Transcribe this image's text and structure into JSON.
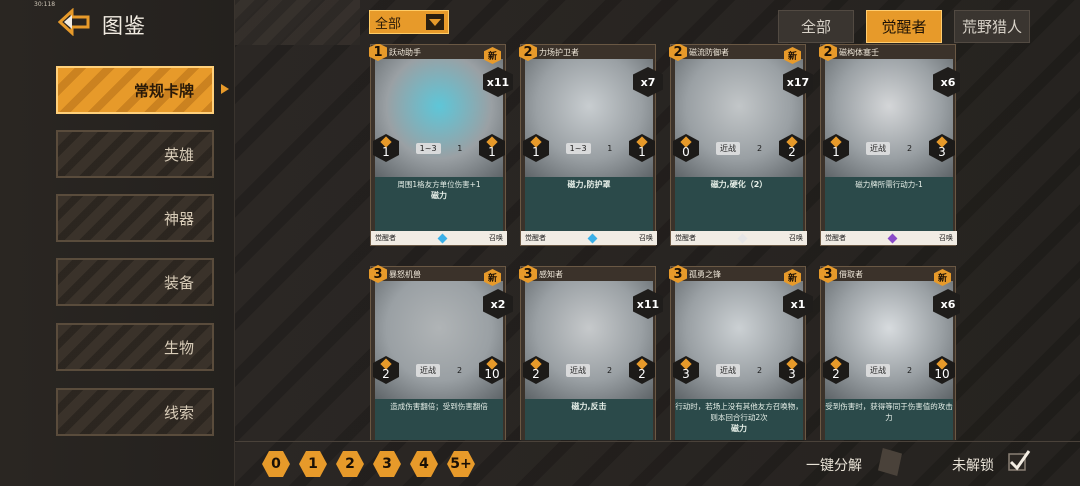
{
  "status": {
    "clock": "30:118"
  },
  "header": {
    "title": "图鉴"
  },
  "sidebar": {
    "items": [
      {
        "label": "常规卡牌",
        "active": true
      },
      {
        "label": "英雄"
      },
      {
        "label": "神器"
      },
      {
        "label": "装备"
      },
      {
        "label": "生物"
      },
      {
        "label": "线索"
      }
    ]
  },
  "filter": {
    "selected": "全部"
  },
  "tabs": [
    {
      "label": "全部"
    },
    {
      "label": "觉醒者",
      "active": true
    },
    {
      "label": "荒野猎人"
    }
  ],
  "cards": [
    {
      "cost": "1",
      "name": "跃动助手",
      "new": "新",
      "count": "x11",
      "left": "1",
      "range": "1~3",
      "mid": "1",
      "right": "1",
      "desc": "周围1格友方单位伤害+1",
      "kw": "磁力",
      "faction": "觉醒者",
      "type": "召唤",
      "gem": "#3ab0e8",
      "art": "#5ec6d8"
    },
    {
      "cost": "2",
      "name": "力场护卫者",
      "new": "",
      "count": "x7",
      "left": "1",
      "range": "1~3",
      "mid": "1",
      "right": "1",
      "desc": "",
      "kw": "磁力,防护罩",
      "faction": "觉醒者",
      "type": "召唤",
      "gem": "#3ab0e8",
      "art": "#c8cdd0"
    },
    {
      "cost": "2",
      "name": "磁流防御者",
      "new": "新",
      "count": "x17",
      "left": "0",
      "range": "近战",
      "mid": "2",
      "right": "2",
      "desc": "",
      "kw": "磁力,硬化（2）",
      "faction": "觉醒者",
      "type": "召唤",
      "gem": "#e6e6e6",
      "art": "#c2c6c8"
    },
    {
      "cost": "2",
      "name": "磁构体塞壬",
      "new": "",
      "count": "x6",
      "left": "1",
      "range": "近战",
      "mid": "2",
      "right": "3",
      "desc": "磁力牌所需行动力-1",
      "kw": "",
      "faction": "觉醒者",
      "type": "召唤",
      "gem": "#8a4bc8",
      "art": "#d4d6d8"
    },
    {
      "cost": "3",
      "name": "暴怒机兽",
      "new": "新",
      "count": "x2",
      "left": "2",
      "range": "近战",
      "mid": "2",
      "right": "10",
      "desc": "造成伤害翻倍；受到伤害翻倍",
      "kw": "",
      "faction": "",
      "type": "",
      "gem": "",
      "art": "#b0b4b6"
    },
    {
      "cost": "3",
      "name": "感知者",
      "new": "",
      "count": "x11",
      "left": "2",
      "range": "近战",
      "mid": "2",
      "right": "2",
      "desc": "",
      "kw": "磁力,反击",
      "faction": "",
      "type": "",
      "gem": "",
      "art": "#c6c9cb"
    },
    {
      "cost": "3",
      "name": "孤勇之锋",
      "new": "新",
      "count": "x1",
      "left": "3",
      "range": "近战",
      "mid": "2",
      "right": "3",
      "desc": "行动时，若场上没有其他友方召唤物，则本回合行动2次",
      "kw": "磁力",
      "faction": "",
      "type": "",
      "gem": "",
      "art": "#cbd0d3"
    },
    {
      "cost": "3",
      "name": "借取者",
      "new": "新",
      "count": "x6",
      "left": "2",
      "range": "近战",
      "mid": "2",
      "right": "10",
      "desc": "受到伤害时，获得等同于伤害值的攻击力",
      "kw": "",
      "faction": "",
      "type": "",
      "gem": "",
      "art": "#d7dbde"
    }
  ],
  "pager": [
    "0",
    "1",
    "2",
    "3",
    "4",
    "5+"
  ],
  "bottom": {
    "disassemble": "一键分解",
    "unlocked": "未解锁"
  }
}
